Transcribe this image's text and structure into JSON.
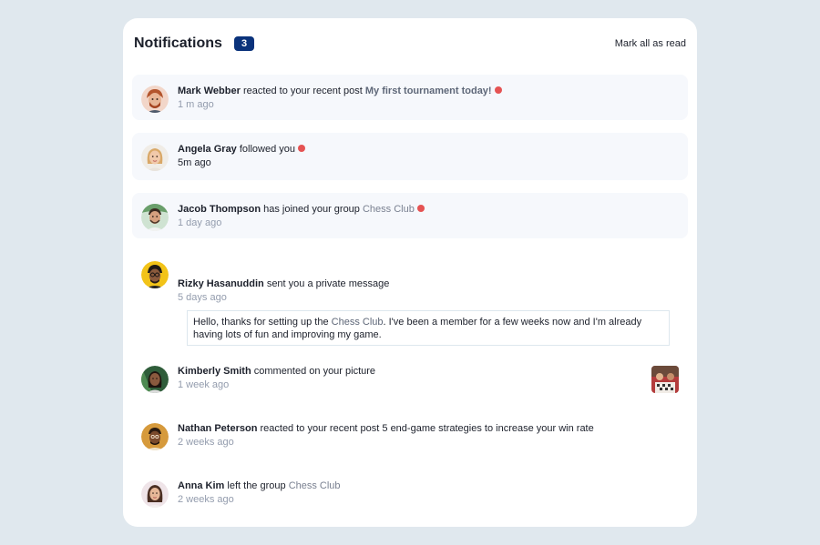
{
  "header": {
    "title": "Notifications",
    "count": "3",
    "mark_all_label": "Mark all as read"
  },
  "notifications": [
    {
      "name": "Mark Webber",
      "action": "reacted to your recent post",
      "target": "My first tournament today!",
      "time": "1 m ago",
      "unread": true,
      "avatar_icon": "avatar-mark-webber"
    },
    {
      "name": "Angela Gray",
      "action": "followed you",
      "target": "",
      "time": "5m ago",
      "unread": true,
      "avatar_icon": "avatar-angela-gray"
    },
    {
      "name": "Jacob Thompson",
      "action": "has joined your group",
      "target": "Chess Club",
      "time": "1 day ago",
      "unread": true,
      "avatar_icon": "avatar-jacob-thompson"
    },
    {
      "name": "Rizky Hasanuddin",
      "action": "sent you a private message",
      "target": "",
      "time": "5 days ago",
      "unread": false,
      "avatar_icon": "avatar-rizky-hasanuddin",
      "message_before": "Hello, thanks for setting up the ",
      "message_link": "Chess Club",
      "message_after": ". I've been a member for a few weeks now and I'm already having lots of fun and improving my game."
    },
    {
      "name": "Kimberly Smith",
      "action": "commented on your picture",
      "target": "",
      "time": "1 week ago",
      "unread": false,
      "avatar_icon": "avatar-kimberly-smith",
      "picture_icon": "chess-picture-thumbnail"
    },
    {
      "name": "Nathan Peterson",
      "action": "reacted to your recent post 5 end-game strategies to increase your win rate",
      "target": "",
      "time": "2 weeks ago",
      "unread": false,
      "avatar_icon": "avatar-nathan-peterson"
    },
    {
      "name": "Anna Kim",
      "action": "left the group",
      "target": "Chess Club",
      "time": "2 weeks ago",
      "unread": false,
      "avatar_icon": "avatar-anna-kim"
    }
  ],
  "colors": {
    "background": "#e0e8ee",
    "card": "#ffffff",
    "unread_bg": "#f6f8fc",
    "badge": "#0a327b",
    "dot": "#e55353",
    "text_dark": "#1c202b",
    "text_muted": "#939cad"
  }
}
